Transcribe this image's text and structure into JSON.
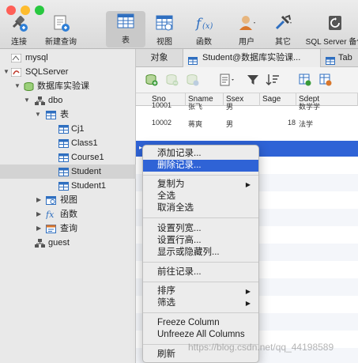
{
  "toolbar": {
    "buttons": [
      {
        "label": "连接",
        "icon": "plug-connect-icon"
      },
      {
        "label": "新建查询",
        "icon": "new-query-icon"
      },
      {
        "label": "表",
        "icon": "table-icon"
      },
      {
        "label": "视图",
        "icon": "view-icon"
      },
      {
        "label": "函数",
        "icon": "function-icon"
      },
      {
        "label": "用户",
        "icon": "user-icon"
      },
      {
        "label": "其它",
        "icon": "tools-icon"
      },
      {
        "label": "SQL Server 备份",
        "icon": "backup-icon"
      }
    ]
  },
  "sidebar": {
    "items": [
      {
        "label": "mysql",
        "icon": "mysql-connection-icon"
      },
      {
        "label": "SQLServer",
        "icon": "sqlserver-connection-icon"
      },
      {
        "label": "数据库实验课",
        "icon": "database-icon"
      },
      {
        "label": "dbo",
        "icon": "schema-icon"
      },
      {
        "label": "表",
        "icon": "tables-folder-icon"
      },
      {
        "label": "Cj1",
        "icon": "table-icon"
      },
      {
        "label": "Class1",
        "icon": "table-icon"
      },
      {
        "label": "Course1",
        "icon": "table-icon"
      },
      {
        "label": "Student",
        "icon": "table-icon"
      },
      {
        "label": "Student1",
        "icon": "table-icon"
      },
      {
        "label": "视图",
        "icon": "views-folder-icon"
      },
      {
        "label": "函数",
        "icon": "functions-folder-icon"
      },
      {
        "label": "查询",
        "icon": "queries-folder-icon"
      },
      {
        "label": "guest",
        "icon": "schema-icon"
      }
    ]
  },
  "tabs": [
    {
      "label": "对象"
    },
    {
      "label": "Student@数据库实验课..."
    },
    {
      "label": "Tab"
    }
  ],
  "grid": {
    "columns": [
      "Sno",
      "Sname",
      "Ssex",
      "Sage",
      "Sdept"
    ],
    "rows": [
      [
        "10001",
        "张飞",
        "男",
        "",
        "数学学"
      ],
      [
        "10002",
        "蒋爽",
        "男",
        "18",
        "法学"
      ]
    ],
    "row_b_age": "18"
  },
  "context_menu": {
    "items": [
      {
        "label": "添加记录..."
      },
      {
        "label": "删除记录..."
      },
      {
        "label": "复制为"
      },
      {
        "label": "全选"
      },
      {
        "label": "取消全选"
      },
      {
        "label": "设置列宽..."
      },
      {
        "label": "设置行高..."
      },
      {
        "label": "显示或隐藏列..."
      },
      {
        "label": "前往记录..."
      },
      {
        "label": "排序"
      },
      {
        "label": "筛选"
      },
      {
        "label": "Freeze Column"
      },
      {
        "label": "Unfreeze All Columns"
      },
      {
        "label": "刷新"
      }
    ]
  },
  "watermark": "https://blog.csdn.net/qq_44198589",
  "colors": {
    "accent": "#2f63d6",
    "traffic_red": "#ff5f57",
    "traffic_yellow": "#febc2e",
    "traffic_green": "#28c840"
  }
}
